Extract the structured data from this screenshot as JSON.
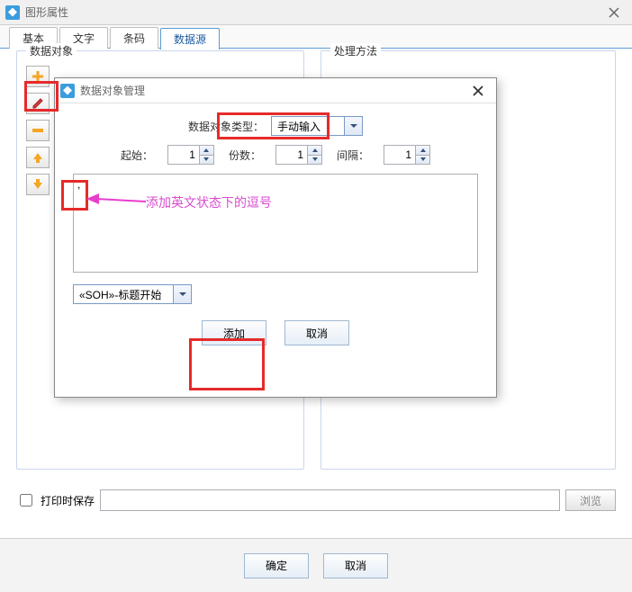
{
  "mainWindow": {
    "title": "图形属性",
    "tabs": [
      "基本",
      "文字",
      "条码",
      "数据源"
    ],
    "activeTab": 3,
    "group_left": "数据对象",
    "group_right": "处理方法",
    "print_save": "打印时保存",
    "browse": "浏览",
    "ok": "确定",
    "cancel": "取消"
  },
  "dialog": {
    "title": "数据对象管理",
    "type_label": "数据对象类型：",
    "type_value": "手动输入",
    "start_label": "起始：",
    "start_value": "1",
    "copies_label": "份数：",
    "copies_value": "1",
    "interval_label": "间隔：",
    "interval_value": "1",
    "textarea_value": ",",
    "control_combo": "«SOH»-标题开始",
    "add": "添加",
    "cancel": "取消"
  },
  "annotation": "添加英文状态下的逗号"
}
